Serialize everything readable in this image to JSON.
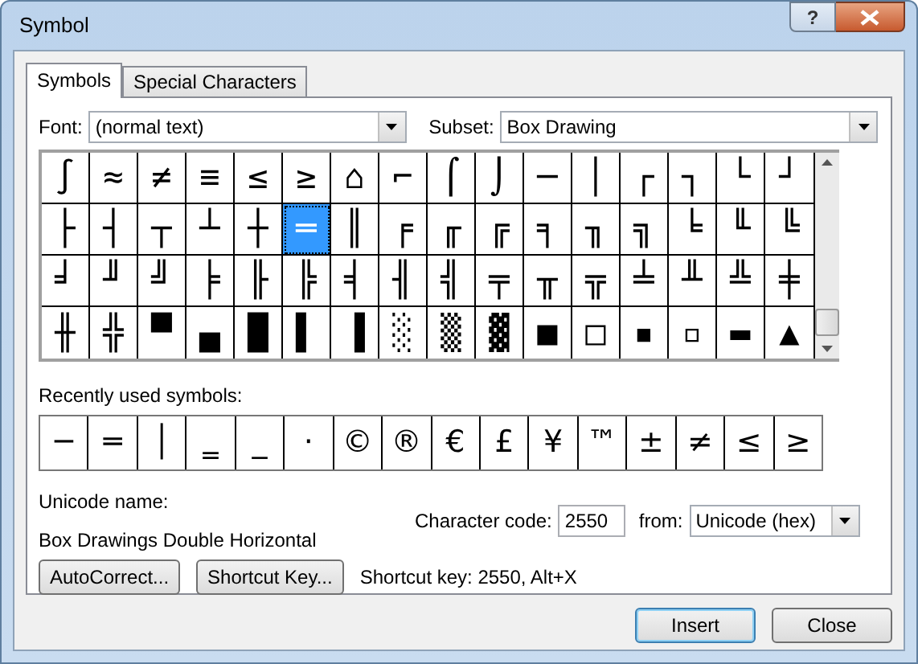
{
  "window": {
    "title": "Symbol",
    "help": "?"
  },
  "tabs": [
    {
      "label": "Symbols",
      "selected": true
    },
    {
      "label": "Special Characters",
      "selected": false
    }
  ],
  "font": {
    "label": "Font:",
    "value": "(normal text)"
  },
  "subset": {
    "label": "Subset:",
    "value": "Box Drawing"
  },
  "symbol_rows": [
    [
      {
        "char": "∫",
        "selected": false
      },
      {
        "char": "≈",
        "selected": false
      },
      {
        "char": "≠",
        "selected": false
      },
      {
        "char": "≡",
        "selected": false
      },
      {
        "char": "≤",
        "selected": false
      },
      {
        "char": "≥",
        "selected": false
      },
      {
        "char": "⌂",
        "selected": false
      },
      {
        "char": "⌐",
        "selected": false
      },
      {
        "char": "⌠",
        "selected": false
      },
      {
        "char": "⌡",
        "selected": false
      },
      {
        "char": "─",
        "selected": false
      },
      {
        "char": "│",
        "selected": false
      },
      {
        "char": "┌",
        "selected": false
      },
      {
        "char": "┐",
        "selected": false
      },
      {
        "char": "└",
        "selected": false
      },
      {
        "char": "┘",
        "selected": false
      }
    ],
    [
      {
        "char": "├",
        "selected": false
      },
      {
        "char": "┤",
        "selected": false
      },
      {
        "char": "┬",
        "selected": false
      },
      {
        "char": "┴",
        "selected": false
      },
      {
        "char": "┼",
        "selected": false
      },
      {
        "char": "═",
        "selected": true
      },
      {
        "char": "║",
        "selected": false
      },
      {
        "char": "╒",
        "selected": false
      },
      {
        "char": "╓",
        "selected": false
      },
      {
        "char": "╔",
        "selected": false
      },
      {
        "char": "╕",
        "selected": false
      },
      {
        "char": "╖",
        "selected": false
      },
      {
        "char": "╗",
        "selected": false
      },
      {
        "char": "╘",
        "selected": false
      },
      {
        "char": "╙",
        "selected": false
      },
      {
        "char": "╚",
        "selected": false
      }
    ],
    [
      {
        "char": "╛",
        "selected": false
      },
      {
        "char": "╜",
        "selected": false
      },
      {
        "char": "╝",
        "selected": false
      },
      {
        "char": "╞",
        "selected": false
      },
      {
        "char": "╟",
        "selected": false
      },
      {
        "char": "╠",
        "selected": false
      },
      {
        "char": "╡",
        "selected": false
      },
      {
        "char": "╢",
        "selected": false
      },
      {
        "char": "╣",
        "selected": false
      },
      {
        "char": "╤",
        "selected": false
      },
      {
        "char": "╥",
        "selected": false
      },
      {
        "char": "╦",
        "selected": false
      },
      {
        "char": "╧",
        "selected": false
      },
      {
        "char": "╨",
        "selected": false
      },
      {
        "char": "╩",
        "selected": false
      },
      {
        "char": "╪",
        "selected": false
      }
    ],
    [
      {
        "char": "╫",
        "selected": false
      },
      {
        "char": "╬",
        "selected": false
      },
      {
        "char": "▀",
        "selected": false
      },
      {
        "char": "▄",
        "selected": false
      },
      {
        "char": "█",
        "selected": false
      },
      {
        "char": "▌",
        "selected": false
      },
      {
        "char": "▐",
        "selected": false
      },
      {
        "char": "░",
        "selected": false
      },
      {
        "char": "▒",
        "selected": false
      },
      {
        "char": "▓",
        "selected": false
      },
      {
        "char": "■",
        "selected": false
      },
      {
        "char": "□",
        "selected": false
      },
      {
        "char": "▪",
        "selected": false
      },
      {
        "char": "▫",
        "selected": false
      },
      {
        "char": "▬",
        "selected": false
      },
      {
        "char": "▲",
        "selected": false
      }
    ]
  ],
  "recent": {
    "label": "Recently used symbols:",
    "symbols": [
      "─",
      "═",
      "│",
      "‗",
      "_",
      "·",
      "©",
      "®",
      "€",
      "£",
      "¥",
      "™",
      "±",
      "≠",
      "≤",
      "≥"
    ]
  },
  "unicode_name": {
    "label": "Unicode name:",
    "value": "Box Drawings Double Horizontal"
  },
  "character_code": {
    "label": "Character code:",
    "value": "2550"
  },
  "from": {
    "label": "from:",
    "value": "Unicode (hex)"
  },
  "buttons": [
    {
      "label": "AutoCorrect..."
    },
    {
      "label": "Shortcut Key..."
    }
  ],
  "shortcut_text": "Shortcut key: 2550, Alt+X",
  "footer_buttons": [
    {
      "label": "Insert",
      "default": true
    },
    {
      "label": "Close",
      "default": false
    }
  ]
}
